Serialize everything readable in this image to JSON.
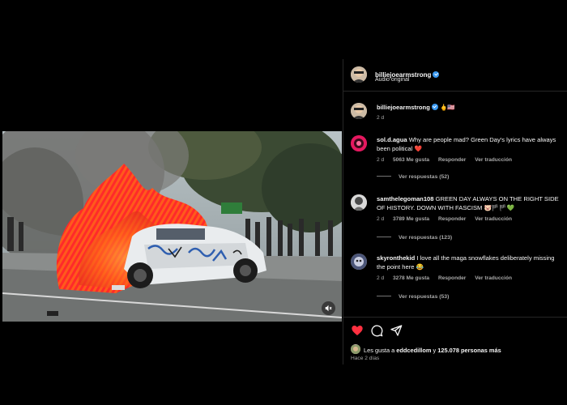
{
  "colors": {
    "background": "#000000",
    "verified": "#3897f0",
    "heart": "#ff3040",
    "muted_text": "#a8a8a8",
    "divider": "#262626"
  },
  "video": {
    "mute_icon": "speaker-muted-icon"
  },
  "post_header": {
    "username": "billiejoearmstrong",
    "audio_label": "Audio original"
  },
  "caption": {
    "username": "billiejoearmstrong",
    "emoji": "🖕🇺🇸",
    "time": "2 d"
  },
  "comments": [
    {
      "username": "sol.d.agua",
      "text": "Why are people mad? Green Day's lyrics have always been political ❤️",
      "time": "2 d",
      "likes": "5063 Me gusta",
      "reply": "Responder",
      "translate": "Ver traducción",
      "view_replies": "Ver respuestas (52)"
    },
    {
      "username": "samthelegoman108",
      "text": "GREEN DAY ALWAYS ON THE RIGHT SIDE OF HISTORY. DOWN WITH FASCISM 🐷🏴🏴💚",
      "time": "2 d",
      "likes": "3789 Me gusta",
      "reply": "Responder",
      "translate": "Ver traducción",
      "view_replies": "Ver respuestas (123)"
    },
    {
      "username": "skyronthekid",
      "text": "I love all the maga snowflakes deliberately missing the point here 😂",
      "time": "2 d",
      "likes": "3278 Me gusta",
      "reply": "Responder",
      "translate": "Ver traducción",
      "view_replies": "Ver respuestas (53)"
    }
  ],
  "actions": {
    "like_icon": "heart-filled-icon",
    "comment_icon": "comment-icon",
    "share_icon": "send-icon",
    "likes_prefix": "Les gusta a",
    "likes_user": "eddcedillom",
    "likes_joiner": "y",
    "likes_count": "125.078 personas más",
    "date": "Hace 2 días"
  }
}
